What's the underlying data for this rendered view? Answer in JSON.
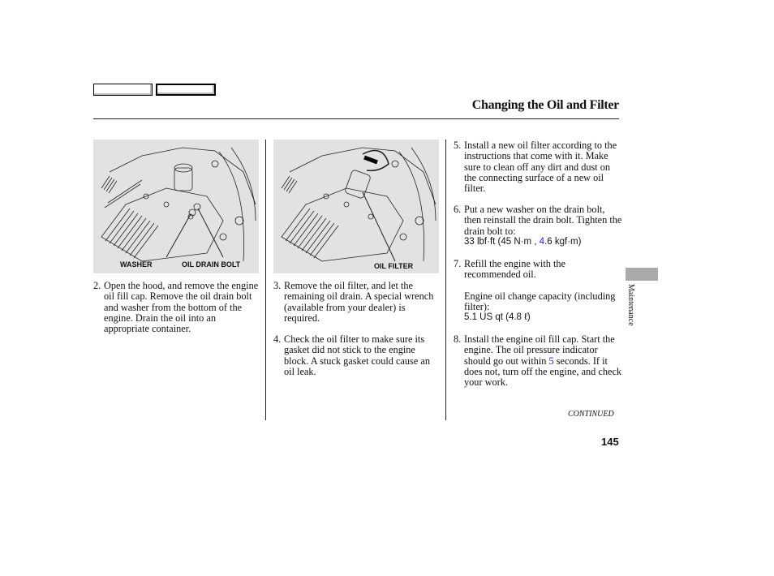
{
  "header": {
    "nav_boxes": [
      "",
      ""
    ],
    "title": "Changing the Oil and Filter"
  },
  "figures": [
    {
      "name": "drain-bolt-illustration",
      "labels": [
        "WASHER",
        "OIL DRAIN BOLT"
      ]
    },
    {
      "name": "oil-filter-illustration",
      "labels": [
        "OIL FILTER"
      ]
    }
  ],
  "steps": [
    {
      "num": "2.",
      "text": "Open the hood, and remove the engine oil fill cap. Remove the oil drain bolt and washer from the bottom of the engine. Drain the oil into an appropriate container."
    },
    {
      "num": "3.",
      "text": "Remove the oil filter, and let the remaining oil drain. A special wrench (available from your dealer) is required."
    },
    {
      "num": "4.",
      "text": "Check the oil filter to make sure its gasket did not stick to the engine block. A stuck gasket could cause an oil leak."
    },
    {
      "num": "5.",
      "text": "Install a new oil filter according to the instructions that come with it. Make sure to clean off any dirt and dust on the connecting surface of a new oil filter."
    },
    {
      "num": "6.",
      "text": "Put a new washer on the drain bolt, then reinstall the drain bolt. Tighten the drain bolt to:",
      "spec_pre": "33 lbf·ft (45 N·m , ",
      "spec_blue": "4",
      "spec_post": ".6 kgf·m)"
    },
    {
      "num": "7.",
      "text": "Refill the engine with the recommended oil.",
      "note": "Engine oil change capacity (including filter):",
      "spec": "5.1 US qt (4.8 ℓ)"
    },
    {
      "num": "8.",
      "text_pre": "Install the engine oil fill cap. Start the engine. The oil pressure indicator should go out within ",
      "text_blue": "5",
      "text_post": " seconds. If it does not, turn off the engine, and check your work."
    }
  ],
  "footer": {
    "continued": "CONTINUED",
    "page_number": "145",
    "section_tab": "Maintenance"
  },
  "colors": {
    "figure_bg": "#e2e2e2",
    "section_tab": "#aaaaaa",
    "link_blue": "#1a1aff"
  }
}
